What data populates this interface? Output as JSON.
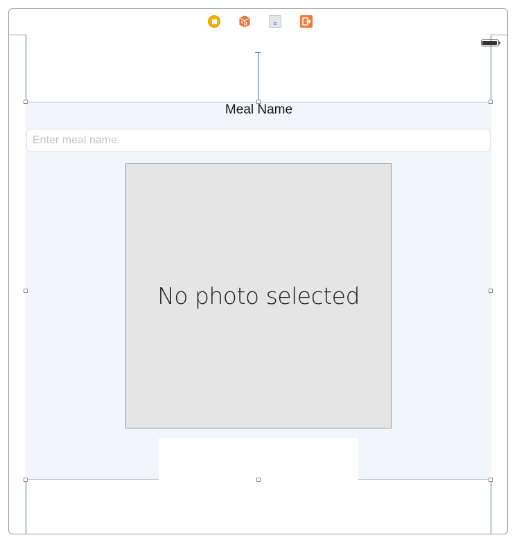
{
  "scene_dock": {
    "icons": [
      {
        "name": "view-controller-icon",
        "color": "#F4B400"
      },
      {
        "name": "first-responder-icon",
        "color": "#EF7A3A"
      },
      {
        "name": "tap-gesture-recognizer-icon",
        "color": "#4A8FE2"
      },
      {
        "name": "exit-icon",
        "color": "#EF7A3A"
      }
    ]
  },
  "form": {
    "label": "Meal Name",
    "name_placeholder": "Enter meal name",
    "name_value": ""
  },
  "photo": {
    "placeholder_text": "No photo selected"
  },
  "status_bar": {
    "battery_icon": "battery-full-icon"
  },
  "colors": {
    "stack_background": "#F2F6FB",
    "photo_background": "#E4E5E4",
    "guide_line": "#3A6F9C"
  }
}
